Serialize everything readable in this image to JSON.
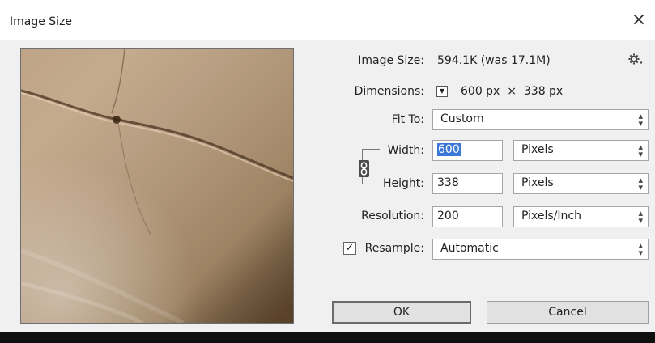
{
  "window": {
    "title": "Image Size",
    "close_symbol": "×"
  },
  "info": {
    "image_size_label": "Image Size:",
    "image_size_value": "594.1K (was 17.1M)",
    "dimensions_label": "Dimensions:",
    "dimensions_value": "600 px  ×  338 px"
  },
  "fit_to": {
    "label": "Fit To:",
    "value": "Custom"
  },
  "width": {
    "label": "Width:",
    "value": "600",
    "unit": "Pixels"
  },
  "height": {
    "label": "Height:",
    "value": "338",
    "unit": "Pixels"
  },
  "resolution": {
    "label": "Resolution:",
    "value": "200",
    "unit": "Pixels/Inch"
  },
  "resample": {
    "label": "Resample:",
    "checked": true,
    "value": "Automatic"
  },
  "buttons": {
    "ok": "OK",
    "cancel": "Cancel"
  },
  "icons": {
    "gear": "gear-icon",
    "dropdown": "dropdown-arrow-icon",
    "link": "chain-link-icon",
    "check": "checkmark-icon"
  },
  "colors": {
    "selection": "#3b78d8",
    "dialog_bg": "#f0f0f0"
  }
}
